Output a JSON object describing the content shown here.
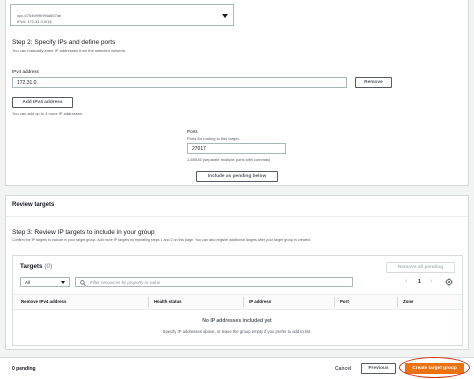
{
  "vpc": {
    "line1": "-",
    "line2": "vpc-0754b99b9f4d657ab",
    "line3": "IPv4: 172.31.0.0/16"
  },
  "step2": {
    "title": "Step 2: Specify IPs and define ports",
    "description": "You can manually enter IP addresses from the selected network.",
    "ipv4_label": "IPv4 address",
    "ipv4_value": "172.31.0.",
    "remove_label": "Remove",
    "add_ipv4_label": "Add IPv4 address",
    "add_hint": "You can add up to 4 more IP addresses.",
    "ports_label": "Ports",
    "ports_hint": "Ports for routing to this target.",
    "ports_value": "27017",
    "ports_range": "1-65535 (separate multiple ports with commas)",
    "include_pending_label": "Include as pending below"
  },
  "review": {
    "header": "Review targets",
    "step3_title": "Step 3: Review IP targets to include in your group",
    "step3_desc": "Confirm the IP targets to include in your target group. Add more IP targets by repeating steps 1 and 2 on this page. You can also register additional targets after your target group is created.",
    "targets_title": "Targets",
    "targets_count": "(0)",
    "remove_all_pending": "Remove all pending",
    "filter_select": "All",
    "filter_placeholder": "Filter resources by property or value",
    "page_number": "1",
    "columns": [
      "Remove IPv4 address",
      "Health status",
      "IP address",
      "Port",
      "Zone"
    ],
    "empty_title": "No IP addresses included yet",
    "empty_desc": "Specify IP addresses above, or leave the group empty if you prefer to add to list."
  },
  "footer": {
    "pending": "0 pending",
    "cancel": "Cancel",
    "previous": "Previous",
    "create": "Create target group"
  },
  "colors": {
    "primary": "#ec7211",
    "highlight": "#d13212"
  }
}
